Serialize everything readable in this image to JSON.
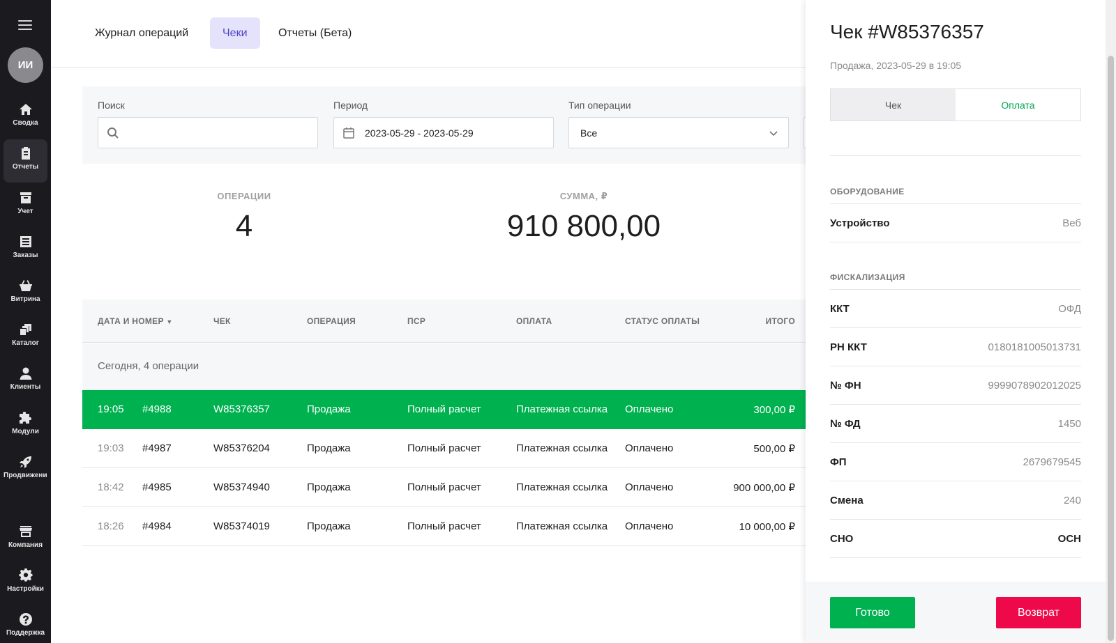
{
  "sidebar": {
    "avatar_initials": "ИИ",
    "items": [
      {
        "label": "Сводка",
        "icon": "home-icon"
      },
      {
        "label": "Отчеты",
        "icon": "clipboard-icon"
      },
      {
        "label": "Учет",
        "icon": "archive-icon"
      },
      {
        "label": "Заказы",
        "icon": "orders-icon"
      },
      {
        "label": "Витрина",
        "icon": "basket-icon"
      },
      {
        "label": "Каталог",
        "icon": "catalog-icon"
      },
      {
        "label": "Клиенты",
        "icon": "user-icon"
      },
      {
        "label": "Модули",
        "icon": "puzzle-icon"
      },
      {
        "label": "Продвижение",
        "icon": "rocket-icon"
      },
      {
        "label": "Компания",
        "icon": "store-icon"
      },
      {
        "label": "Настройки",
        "icon": "gear-icon"
      },
      {
        "label": "Поддержка",
        "icon": "help-icon"
      }
    ]
  },
  "tabs": [
    {
      "label": "Журнал операций",
      "active": false
    },
    {
      "label": "Чеки",
      "active": true
    },
    {
      "label": "Отчеты (Бета)",
      "active": false
    }
  ],
  "filters": {
    "search_label": "Поиск",
    "search_value": "",
    "period_label": "Период",
    "period_value": "2023-05-29 - 2023-05-29",
    "type_label": "Тип операции",
    "type_value": "Все"
  },
  "stats": {
    "operations_label": "ОПЕРАЦИИ",
    "operations_value": "4",
    "sum_label": "СУММА, ₽",
    "sum_value": "910 800,00"
  },
  "table": {
    "headers": [
      "ДАТА И НОМЕР",
      "ЧЕК",
      "ОПЕРАЦИЯ",
      "ПСР",
      "ОПЛАТА",
      "СТАТУС ОПЛАТЫ",
      "ИТОГО"
    ],
    "group_label": "Сегодня, 4 операции",
    "rows": [
      {
        "time": "19:05",
        "num": "#4988",
        "check": "W85376357",
        "op": "Продажа",
        "psr": "Полный расчет",
        "pay": "Платежная ссылка",
        "status": "Оплачено",
        "total": "300,00 ₽"
      },
      {
        "time": "19:03",
        "num": "#4987",
        "check": "W85376204",
        "op": "Продажа",
        "psr": "Полный расчет",
        "pay": "Платежная ссылка",
        "status": "Оплачено",
        "total": "500,00 ₽"
      },
      {
        "time": "18:42",
        "num": "#4985",
        "check": "W85374940",
        "op": "Продажа",
        "psr": "Полный расчет",
        "pay": "Платежная ссылка",
        "status": "Оплачено",
        "total": "900 000,00 ₽"
      },
      {
        "time": "18:26",
        "num": "#4984",
        "check": "W85374019",
        "op": "Продажа",
        "psr": "Полный расчет",
        "pay": "Платежная ссылка",
        "status": "Оплачено",
        "total": "10 000,00 ₽"
      }
    ]
  },
  "panel": {
    "title": "Чек #W85376357",
    "subtitle": "Продажа, 2023-05-29 в 19:05",
    "seg_check": "Чек",
    "seg_payment": "Оплата",
    "equipment_title": "ОБОРУДОВАНИЕ",
    "device_label": "Устройство",
    "device_value": "Веб",
    "fiscal_title": "ФИСКАЛИЗАЦИЯ",
    "fiscal": [
      {
        "k": "ККТ",
        "v": "ОФД"
      },
      {
        "k": "РН ККТ",
        "v": "0180181005013731"
      },
      {
        "k": "№ ФН",
        "v": "9999078902012025"
      },
      {
        "k": "№ ФД",
        "v": "1450"
      },
      {
        "k": "ФП",
        "v": "2679679545"
      },
      {
        "k": "Смена",
        "v": "240"
      },
      {
        "k": "СНО",
        "v": "ОСН"
      }
    ],
    "done_label": "Готово",
    "refund_label": "Возврат"
  },
  "colors": {
    "accent_green": "#00b14f",
    "refund_red": "#ee0a4a",
    "tab_active_bg": "#e4e3fb",
    "tab_active_text": "#4f44c8",
    "sidebar_bg": "#1b1b1f"
  }
}
